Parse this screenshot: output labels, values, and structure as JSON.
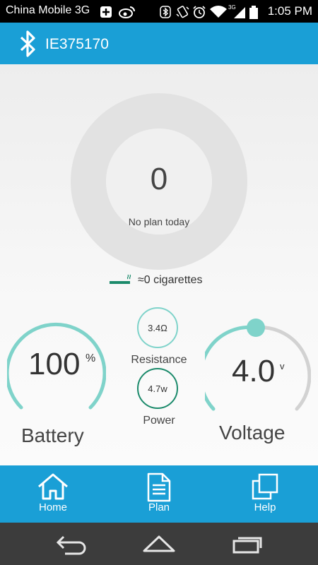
{
  "statusbar": {
    "carrier": "China Mobile 3G",
    "time": "1:05 PM",
    "network_badge": "3G",
    "icons": [
      "add-icon",
      "weibo-icon",
      "bluetooth-icon",
      "vibrate-icon",
      "alarm-icon",
      "wifi-icon",
      "signal-icon",
      "battery-icon"
    ]
  },
  "header": {
    "device_name": "IE375170",
    "icon": "bluetooth-icon"
  },
  "plan": {
    "count": "0",
    "label": "No plan today"
  },
  "cigarettes": {
    "text": "≈0 cigarettes",
    "icon": "cigarette-icon"
  },
  "battery": {
    "value": "100",
    "unit": "%",
    "label": "Battery",
    "level_percent": 100
  },
  "resistance": {
    "value": "3.4Ω",
    "label": "Resistance"
  },
  "power": {
    "value": "4.7w",
    "label": "Power"
  },
  "voltage": {
    "value": "4.0",
    "unit": "v",
    "label": "Voltage"
  },
  "nav": [
    {
      "label": "Home",
      "icon": "home-icon"
    },
    {
      "label": "Plan",
      "icon": "document-icon"
    },
    {
      "label": "Help",
      "icon": "copy-icon"
    }
  ],
  "system_nav": [
    "back-icon",
    "home-outline-icon",
    "recents-icon"
  ],
  "colors": {
    "brand": "#1a9fd6",
    "teal_light": "#7fd3ca",
    "teal_dark": "#1b8a6b",
    "ring": "#e2e2e2"
  }
}
